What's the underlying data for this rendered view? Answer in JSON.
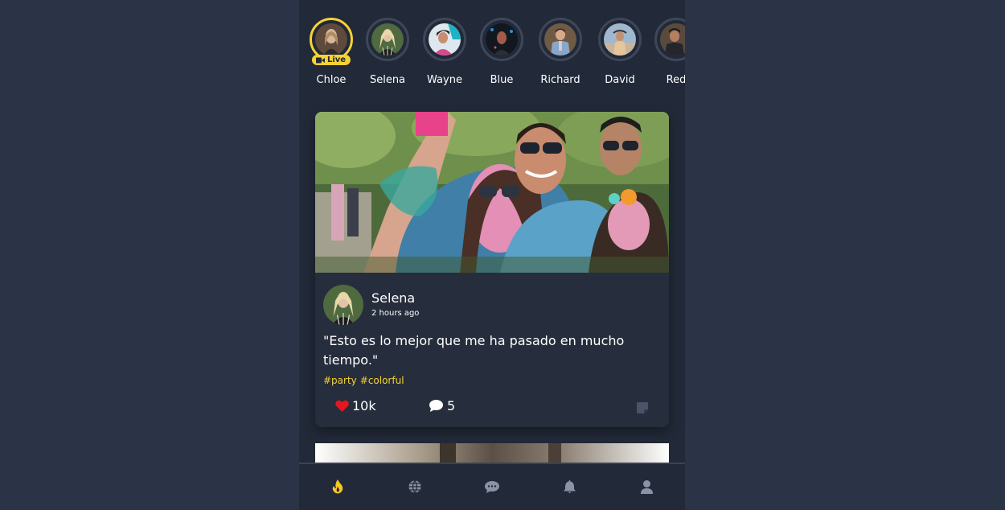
{
  "stories": [
    {
      "name": "Chloe",
      "live": true
    },
    {
      "name": "Selena"
    },
    {
      "name": "Wayne"
    },
    {
      "name": "Blue"
    },
    {
      "name": "Richard"
    },
    {
      "name": "David"
    },
    {
      "name": "Red"
    }
  ],
  "live_label": "Live",
  "post": {
    "author": "Selena",
    "time": "2 hours ago",
    "caption": "\"Esto es lo mejor que me ha pasado en mucho tiempo.\"",
    "tags": [
      "#party",
      "#colorful"
    ],
    "likes": "10k",
    "comments": "5"
  },
  "nav": {
    "items": [
      "flame-icon",
      "globe-icon",
      "chat-icon",
      "bell-icon",
      "user-icon"
    ],
    "active": "flame-icon"
  },
  "colors": {
    "accent": "#f6d233",
    "like": "#e8141e",
    "background": "#2b3446",
    "panel": "#222938",
    "card": "#262d3c"
  }
}
